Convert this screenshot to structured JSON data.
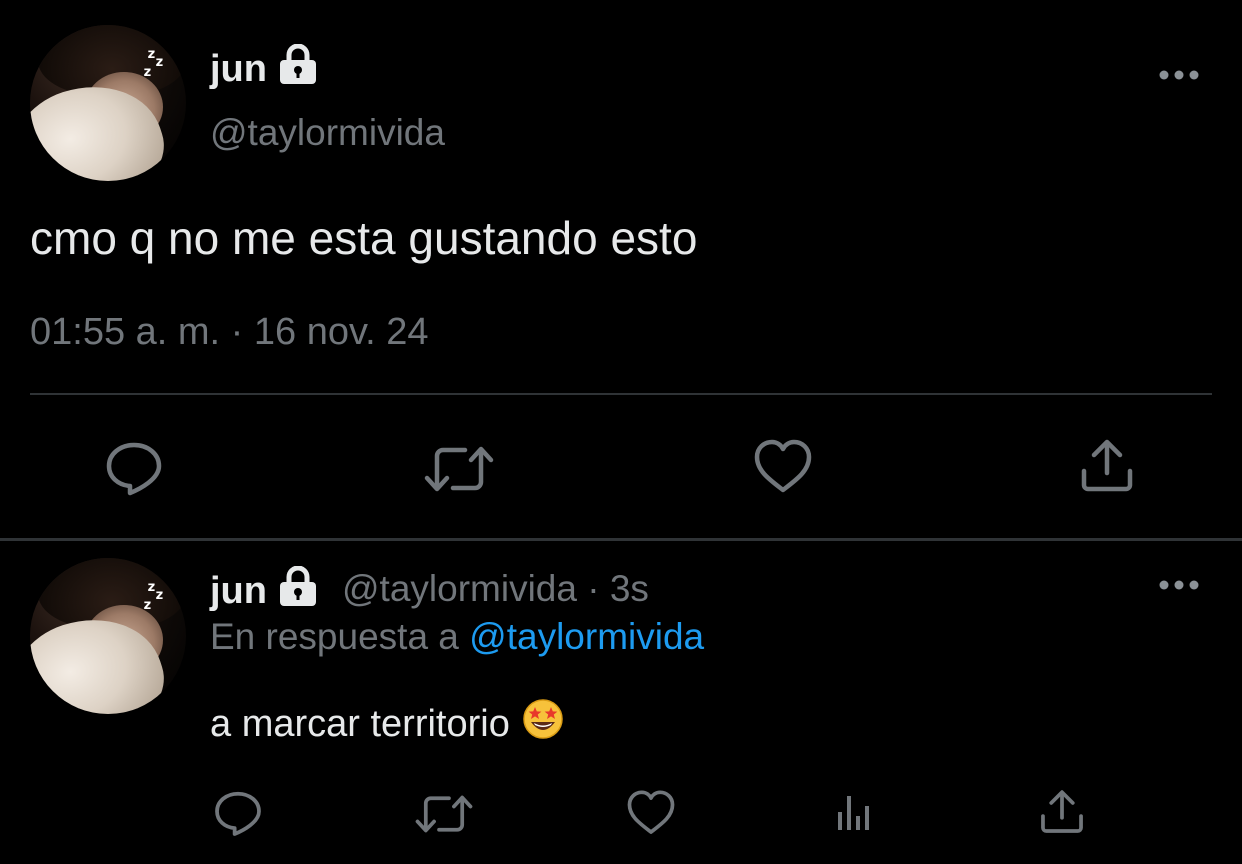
{
  "main_tweet": {
    "display_name": "jun",
    "handle": "@taylormivida",
    "text": "cmo q no me esta gustando esto",
    "timestamp": "01:55 a. m. · 16 nov. 24",
    "avatar_overlay": "z z z",
    "actions": [
      "reply-icon",
      "retweet-icon",
      "like-icon",
      "share-icon"
    ]
  },
  "reply": {
    "display_name": "jun",
    "handle_time": "@taylormivida · 3s",
    "in_reply_prefix": "En respuesta a ",
    "in_reply_mention": "@taylormivida",
    "text": "a marcar territorio",
    "emoji": "star-struck-emoji",
    "actions": [
      "reply-icon",
      "retweet-icon",
      "like-icon",
      "analytics-icon",
      "share-icon"
    ]
  },
  "colors": {
    "background": "#000000",
    "text": "#e7e9ea",
    "muted": "#71767b",
    "divider": "#2f3336",
    "accent": "#1d9bf0"
  }
}
